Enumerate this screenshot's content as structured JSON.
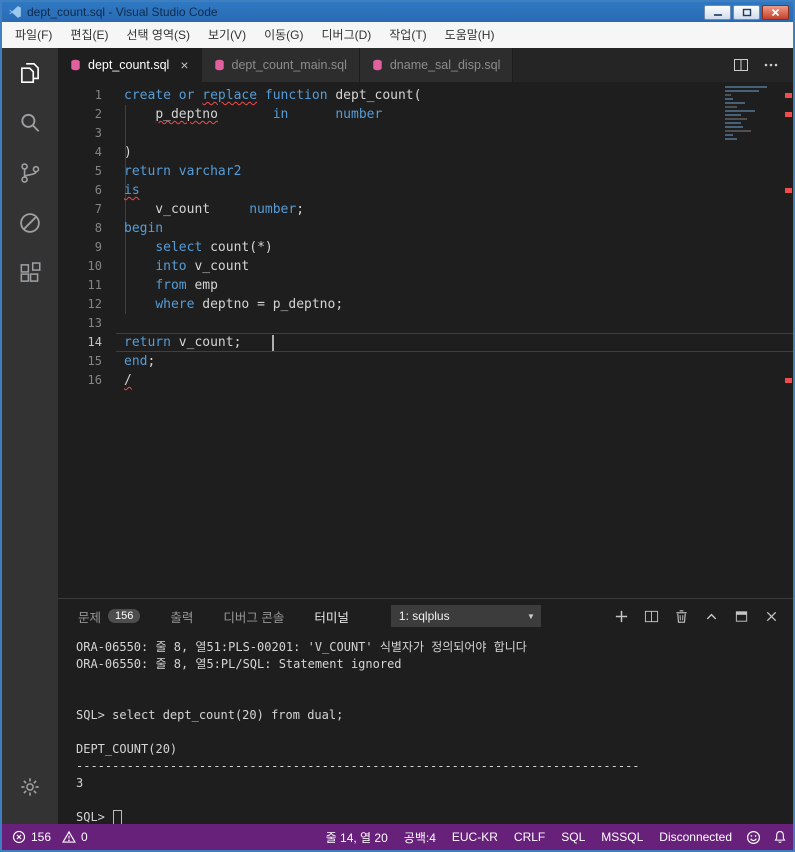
{
  "window": {
    "title": "dept_count.sql - Visual Studio Code"
  },
  "menu": {
    "items": [
      "파일(F)",
      "편집(E)",
      "선택 영역(S)",
      "보기(V)",
      "이동(G)",
      "디버그(D)",
      "작업(T)",
      "도움말(H)"
    ]
  },
  "activity_bar": {
    "items": [
      {
        "name": "explorer-icon",
        "active": true
      },
      {
        "name": "search-icon"
      },
      {
        "name": "source-control-icon"
      },
      {
        "name": "debug-disabled-icon"
      },
      {
        "name": "extensions-icon"
      }
    ],
    "bottom": [
      {
        "name": "gear-icon"
      }
    ]
  },
  "tabs": {
    "items": [
      {
        "label": "dept_count.sql",
        "active": true,
        "icon": "sql-file-icon",
        "close": "×"
      },
      {
        "label": "dept_count_main.sql",
        "icon": "sql-file-icon"
      },
      {
        "label": "dname_sal_disp.sql",
        "icon": "sql-file-icon"
      }
    ],
    "actions": [
      {
        "name": "split-editor-icon"
      },
      {
        "name": "more-actions-icon"
      }
    ]
  },
  "editor": {
    "error_lines": [
      1,
      2,
      6,
      16
    ],
    "cursor_status": "줄 14, 열 20",
    "lines": [
      {
        "n": "1",
        "t": [
          [
            "create or ",
            "kw"
          ],
          [
            "replace",
            "kw sq"
          ],
          [
            " ",
            "pl"
          ],
          [
            "function",
            "kw"
          ],
          [
            " dept_count(",
            "pl"
          ]
        ]
      },
      {
        "n": "2",
        "t": [
          [
            "    ",
            "pl"
          ],
          [
            "p_deptno",
            "pl sq"
          ],
          [
            "       ",
            "pl"
          ],
          [
            "in",
            "kw"
          ],
          [
            "      ",
            "pl"
          ],
          [
            "number",
            "kw"
          ]
        ]
      },
      {
        "n": "3",
        "t": []
      },
      {
        "n": "4",
        "t": [
          [
            ")",
            "pl"
          ]
        ]
      },
      {
        "n": "5",
        "t": [
          [
            "return varchar2",
            "kw"
          ]
        ]
      },
      {
        "n": "6",
        "t": [
          [
            "is",
            "kw sq"
          ]
        ]
      },
      {
        "n": "7",
        "t": [
          [
            "    v_count     ",
            "pl"
          ],
          [
            "number",
            "kw"
          ],
          [
            ";",
            "pl"
          ]
        ]
      },
      {
        "n": "8",
        "t": [
          [
            "begin",
            "kw"
          ]
        ]
      },
      {
        "n": "9",
        "t": [
          [
            "    ",
            "pl"
          ],
          [
            "select",
            "kw"
          ],
          [
            " count(*)",
            "pl"
          ]
        ]
      },
      {
        "n": "10",
        "t": [
          [
            "    ",
            "pl"
          ],
          [
            "into",
            "kw"
          ],
          [
            " v_count",
            "pl"
          ]
        ]
      },
      {
        "n": "11",
        "t": [
          [
            "    ",
            "pl"
          ],
          [
            "from",
            "kw"
          ],
          [
            " emp",
            "pl"
          ]
        ]
      },
      {
        "n": "12",
        "t": [
          [
            "    ",
            "pl"
          ],
          [
            "where",
            "kw"
          ],
          [
            " deptno = p_deptno;",
            "pl"
          ]
        ]
      },
      {
        "n": "13",
        "t": []
      },
      {
        "n": "14",
        "t": [
          [
            "return",
            "kw"
          ],
          [
            " v_count;    ",
            "pl"
          ]
        ],
        "cur": true,
        "cursor": true
      },
      {
        "n": "15",
        "t": [
          [
            "end",
            "kw"
          ],
          [
            ";",
            "pl"
          ]
        ]
      },
      {
        "n": "16",
        "t": [
          [
            "/",
            "pl sq"
          ]
        ]
      }
    ]
  },
  "panel": {
    "tabs": [
      {
        "label": "문제",
        "badge": "156"
      },
      {
        "label": "출력"
      },
      {
        "label": "디버그 콘솔"
      },
      {
        "label": "터미널",
        "active": true
      }
    ],
    "terminal_selector": "1: sqlplus",
    "actions": [
      {
        "name": "new-terminal-icon"
      },
      {
        "name": "split-terminal-icon"
      },
      {
        "name": "kill-terminal-icon"
      },
      {
        "name": "chevron-up-icon"
      },
      {
        "name": "maximize-panel-icon"
      },
      {
        "name": "close-panel-icon"
      }
    ]
  },
  "terminal": {
    "lines": [
      "ORA-06550: 줄 8, 열51:PLS-00201: 'V_COUNT' 식별자가 정의되어야 합니다",
      "ORA-06550: 줄 8, 열5:PL/SQL: Statement ignored",
      "",
      "",
      "SQL> select dept_count(20) from dual;",
      "",
      "DEPT_COUNT(20)",
      "------------------------------------------------------------------------------",
      "3",
      ""
    ],
    "prompt": "SQL> "
  },
  "status_bar": {
    "errors": "156",
    "warnings": "0",
    "items": [
      "줄 14, 열 20",
      "공백:4",
      "EUC-KR",
      "CRLF",
      "SQL",
      "MSSQL",
      "Disconnected"
    ],
    "icons": [
      {
        "name": "feedback-smiley-icon"
      },
      {
        "name": "bell-icon"
      }
    ]
  },
  "colors": {
    "title_bar": "#2E79C2",
    "status_bar": "#68217A",
    "keyword": "#569CD6",
    "error": "#F14C4C",
    "sql_icon": "#E2609E"
  }
}
